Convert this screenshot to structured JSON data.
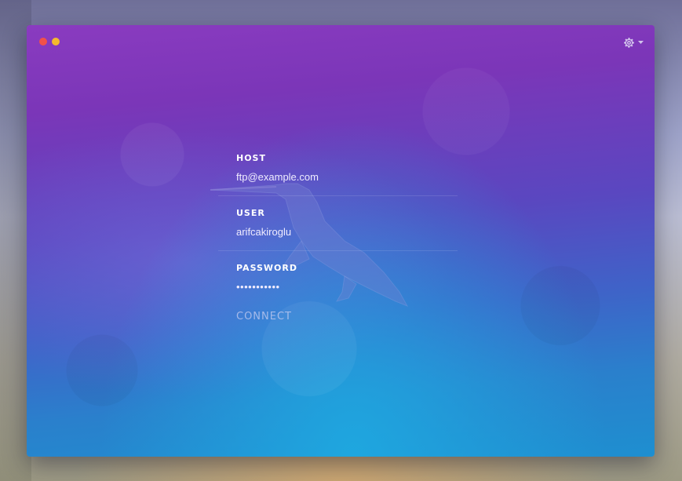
{
  "window": {
    "controls": [
      "close",
      "minimize"
    ],
    "settings_icon": "gear-icon",
    "settings_dropdown_icon": "caret-down-icon"
  },
  "form": {
    "host_label": "HOST",
    "host_value": "ftp@example.com",
    "user_label": "USER",
    "user_value": "arifcakiroglu",
    "password_label": "PASSWORD",
    "password_value": "•••••••••••",
    "connect_label": "CONNECT"
  },
  "colors": {
    "close": "#f2514a",
    "minimize": "#f5b92d",
    "gradient_top": "#8a3bc0",
    "gradient_bottom": "#1e8fd0"
  }
}
